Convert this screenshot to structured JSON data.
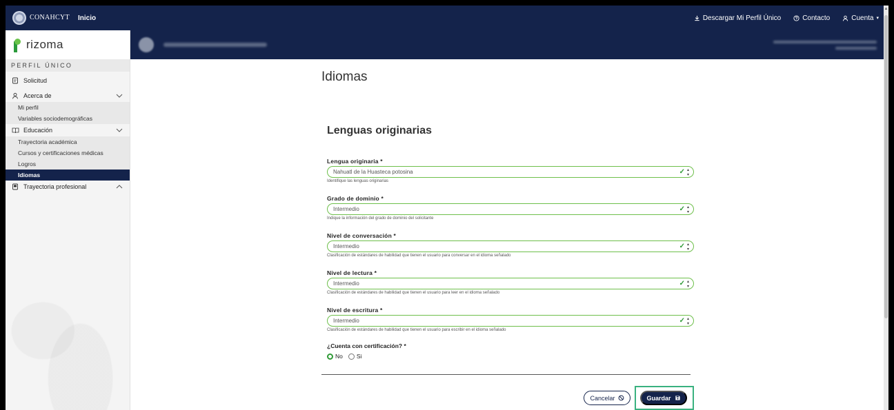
{
  "topbar": {
    "logo_text": "CONAHCYT",
    "logo_subtext": "",
    "inicio": "Inicio",
    "download": "Descargar Mi Perfil Único",
    "contacto": "Contacto",
    "cuenta": "Cuenta"
  },
  "sidebar": {
    "brand": "rizoma",
    "section_heading": "PERFIL ÚNICO",
    "items": [
      {
        "label": "Solicitud",
        "icon": "document-icon"
      },
      {
        "label": "Acerca de",
        "icon": "user-icon",
        "expanded": true
      },
      {
        "label": "Educación",
        "icon": "book-icon",
        "expanded": true
      },
      {
        "label": "Trayectoria profesional",
        "icon": "briefcase-icon",
        "expanded": false
      }
    ],
    "acerca_sub": [
      "Mi perfil",
      "Variables sociodemográficas"
    ],
    "educacion_sub": [
      "Trayectoria académica",
      "Cursos y certificaciones médicas",
      "Logros",
      "Idiomas"
    ],
    "active_item": "Idiomas"
  },
  "main": {
    "page_title": "Idiomas",
    "section_title": "Lenguas originarias",
    "fields": [
      {
        "label": "Lengua originaria *",
        "value": "Nahuatl de la Huasteca potosina",
        "hint": "Identifique las lenguas originarias"
      },
      {
        "label": "Grado de dominio *",
        "value": "Intermedio",
        "hint": "Indique la información del grado de dominio del solicitante"
      },
      {
        "label": "Nivel de conversación *",
        "value": "Intermedio",
        "hint": "Clasificación de estándares de habilidad que tienen el usuario para conversar en el idioma señalado"
      },
      {
        "label": "Nivel de lectura *",
        "value": "Intermedio",
        "hint": "Clasificación de estándares de habilidad que tienen el usuario para leer en el idioma señalado"
      },
      {
        "label": "Nivel de escritura *",
        "value": "Intermedio",
        "hint": "Clasificación de estándares de habilidad que tienen el usuario para escribir en el idioma señalado"
      }
    ],
    "certification": {
      "label": "¿Cuenta con certificación? *",
      "options": [
        "No",
        "Si"
      ],
      "selected": "No"
    },
    "buttons": {
      "cancel": "Cancelar",
      "save": "Guardar"
    }
  },
  "colors": {
    "navy": "#14234b",
    "valid_green": "#6dbf4a",
    "check_green": "#2f9a36",
    "highlight": "#39b17f",
    "brand_green": "#2a9a3b"
  }
}
